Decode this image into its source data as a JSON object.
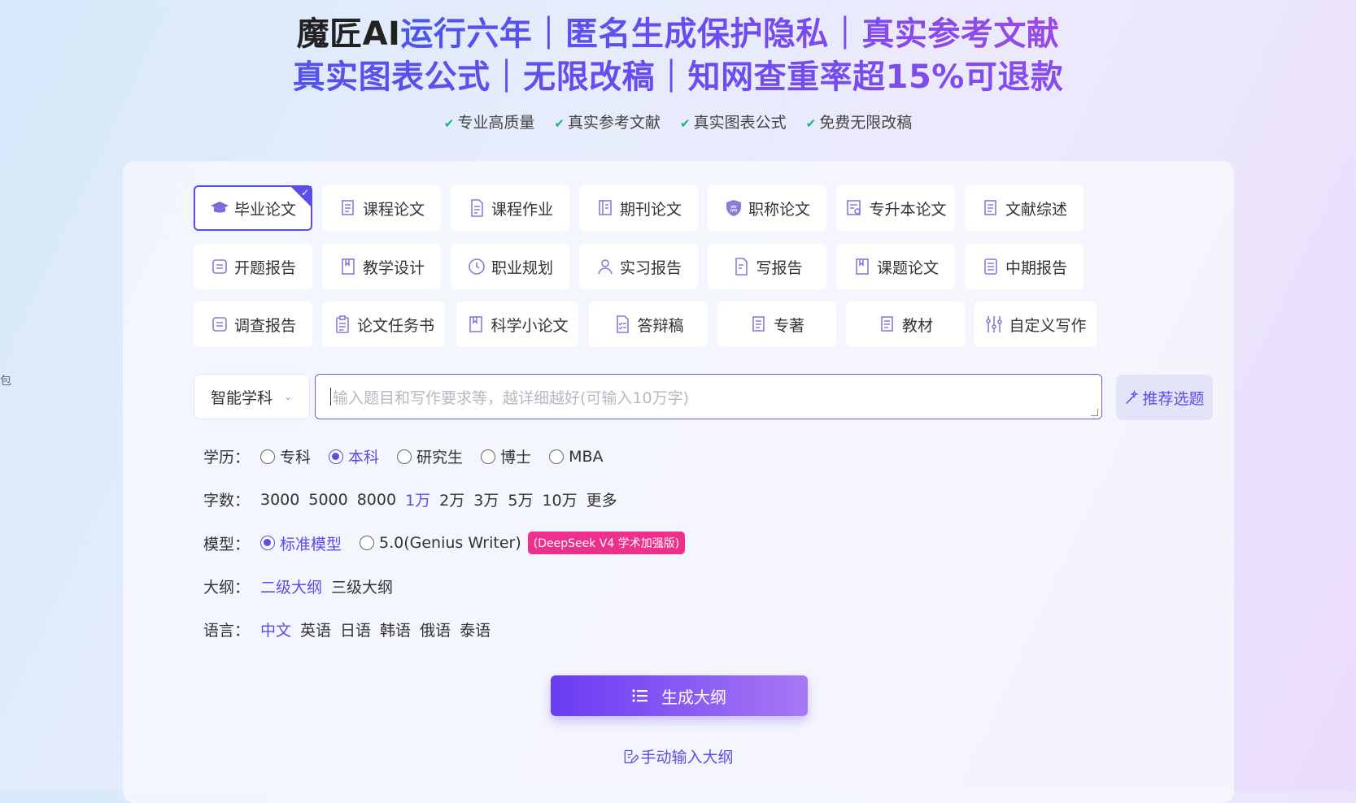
{
  "hero": {
    "brand": "魔匠AI",
    "line1_rest": "运行六年｜匿名生成保护隐私｜真实参考文献",
    "line2": "真实图表公式｜无限改稿｜知网查重率超15%可退款"
  },
  "features": [
    "专业高质量",
    "真实参考文献",
    "真实图表公式",
    "免费无限改稿"
  ],
  "side_char": "包",
  "paper_types": [
    {
      "label": "毕业论文",
      "icon": "graduation-cap-icon",
      "active": true
    },
    {
      "label": "课程论文",
      "icon": "document-icon"
    },
    {
      "label": "课程作业",
      "icon": "file-icon"
    },
    {
      "label": "期刊论文",
      "icon": "journal-icon"
    },
    {
      "label": "职称论文",
      "icon": "shield-badge-icon"
    },
    {
      "label": "专升本论文",
      "icon": "certificate-icon"
    },
    {
      "label": "文献综述",
      "icon": "document-icon"
    },
    {
      "label": "开题报告",
      "icon": "report-icon"
    },
    {
      "label": "教学设计",
      "icon": "book-icon"
    },
    {
      "label": "职业规划",
      "icon": "clock-icon"
    },
    {
      "label": "实习报告",
      "icon": "user-icon"
    },
    {
      "label": "写报告",
      "icon": "file-edit-icon"
    },
    {
      "label": "课题论文",
      "icon": "book-icon"
    },
    {
      "label": "中期报告",
      "icon": "list-doc-icon"
    },
    {
      "label": "调查报告",
      "icon": "report-icon"
    },
    {
      "label": "论文任务书",
      "icon": "clipboard-icon"
    },
    {
      "label": "科学小论文",
      "icon": "book-icon"
    },
    {
      "label": "答辩稿",
      "icon": "checklist-icon"
    },
    {
      "label": "专著",
      "icon": "document-icon"
    },
    {
      "label": "教材",
      "icon": "document-icon"
    },
    {
      "label": "自定义写作",
      "icon": "sliders-icon"
    }
  ],
  "subject": {
    "value": "智能学科"
  },
  "topic": {
    "placeholder": "输入题目和写作要求等，越详细越好(可输入10万字)"
  },
  "recommend": {
    "label": "推荐选题"
  },
  "education": {
    "label": "学历：",
    "options": [
      "专科",
      "本科",
      "研究生",
      "博士",
      "MBA"
    ],
    "selected": "本科"
  },
  "wordcount": {
    "label": "字数：",
    "options": [
      "3000",
      "5000",
      "8000",
      "1万",
      "2万",
      "3万",
      "5万",
      "10万",
      "更多"
    ],
    "selected": "1万"
  },
  "model": {
    "label": "模型：",
    "options": [
      "标准模型",
      "5.0(Genius Writer)"
    ],
    "selected": "标准模型",
    "badge": "(DeepSeek V4 学术加强版)"
  },
  "outline": {
    "label": "大纲：",
    "options": [
      "二级大纲",
      "三级大纲"
    ],
    "selected": "二级大纲"
  },
  "language": {
    "label": "语言：",
    "options": [
      "中文",
      "英语",
      "日语",
      "韩语",
      "俄语",
      "泰语"
    ],
    "selected": "中文"
  },
  "generate": {
    "label": "生成大纲"
  },
  "manual": {
    "label": "手动输入大纲"
  },
  "colors": {
    "accent": "#5a4de8",
    "badge": "#ee2f8c",
    "check": "#19b37a"
  }
}
